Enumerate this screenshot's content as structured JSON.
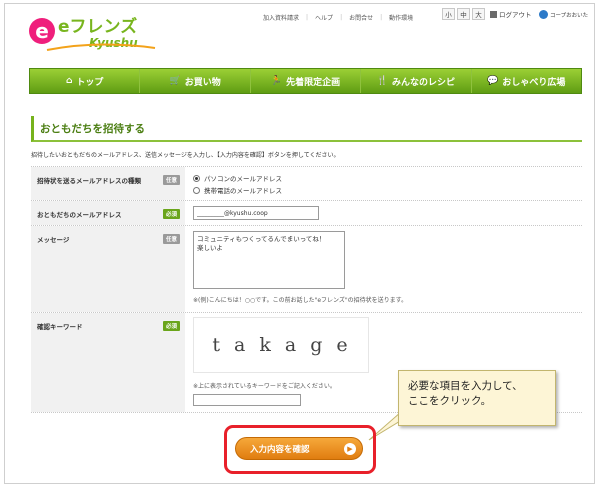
{
  "header": {
    "logo_text": "eフレンズ",
    "logo_sub": "Kyushu",
    "toplinks": [
      "加入資料請求",
      "ヘルプ",
      "お問合せ",
      "動作環境"
    ],
    "size_buttons": [
      "小",
      "中",
      "大"
    ],
    "logout": "ログアウト",
    "coop": "コープおおいた"
  },
  "nav": {
    "items": [
      {
        "label": "トップ",
        "icon": "home-icon",
        "glyph": "⌂"
      },
      {
        "label": "お買い物",
        "icon": "cart-icon",
        "glyph": "🛒"
      },
      {
        "label": "先着限定企画",
        "icon": "runner-icon",
        "glyph": "🏃"
      },
      {
        "label": "みんなのレシピ",
        "icon": "fork-knife-icon",
        "glyph": "🍴"
      },
      {
        "label": "おしゃべり広場",
        "icon": "chat-bubbles-icon",
        "glyph": "💬"
      }
    ]
  },
  "page": {
    "title": "おともだちを招待する",
    "intro": "招待したいおともだちのメールアドレス、送信メッセージを入力し、【入力内容を確認】ボタンを押してください。"
  },
  "form": {
    "badges": {
      "optional": "任意",
      "required": "必須"
    },
    "type": {
      "label": "招待状を送るメールアドレスの種類",
      "options": [
        "パソコンのメールアドレス",
        "携帯電話のメールアドレス"
      ]
    },
    "email": {
      "label": "おともだちのメールアドレス",
      "value": "_________@kyushu.coop"
    },
    "message": {
      "label": "メッセージ",
      "line1": "コミュニティもつくってるんでまいってね！",
      "line2": "楽しいよ",
      "note": "※(例)こんにちは！○○です。この前お話した\"eフレンズ\"の招待状を送ります。"
    },
    "captcha": {
      "label": "確認キーワード",
      "text": "takage",
      "note": "※上に表示されているキーワードをご記入ください。"
    }
  },
  "confirm_button": {
    "label": "入力内容を確認"
  },
  "callout": {
    "line1": "必要な項目を入力して、",
    "line2": "ここをクリック。"
  },
  "colors": {
    "nav_green": "#6aa51a",
    "button_orange": "#e88a1a",
    "highlight_red": "#e8202a",
    "callout_bg": "#fdf5d6"
  }
}
